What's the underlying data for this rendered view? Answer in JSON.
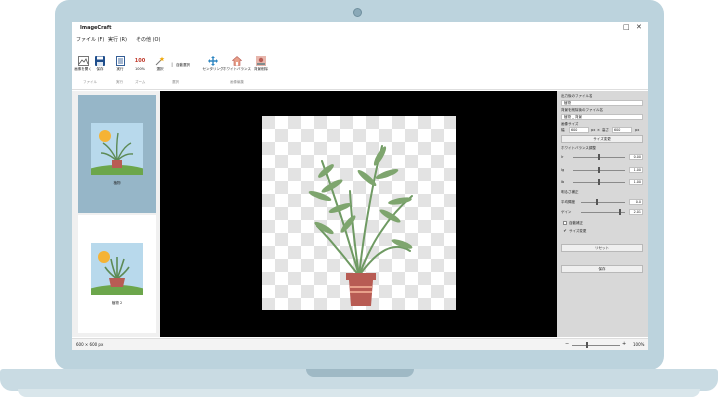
{
  "app": {
    "title": "ImageCraft"
  },
  "window": {
    "maximize": "□",
    "close": "✕"
  },
  "menu": {
    "file": "ファイル (F)",
    "run": "実行 (R)",
    "other": "その他 (O)"
  },
  "toolbar": {
    "open": "画像を開く",
    "save": "保存",
    "run": "実行",
    "zoom100_icon_text": "100",
    "zoom100": "100%",
    "select": "選択",
    "auto_select": "自動選択",
    "centering": "センタリング",
    "white_balance": "ホワイトバランス",
    "bg_remove": "背景削除"
  },
  "groups": {
    "file": "ファイル",
    "run": "実行",
    "zoom": "ズーム",
    "select": "選択",
    "edit": "画像編集"
  },
  "thumbnails": [
    {
      "name": "植物"
    },
    {
      "name": "植物 2"
    }
  ],
  "panel": {
    "output_file_label": "出力後のファイル名",
    "output_file_value": "植物",
    "bg_file_label": "背景を削除後のファイル名",
    "bg_file_value": "植物 _ 背景",
    "image_size_label": "画像サイズ",
    "width_label": "幅",
    "width_value": "600",
    "height_label": "高さ",
    "height_value": "600",
    "unit": "px",
    "times": "×",
    "resize_button": "サイズ変更",
    "wb_label": "ホワイトバランス調整",
    "r_label": "Ir",
    "r_value": "0.00",
    "g_label": "Ig",
    "g_value": "1.00",
    "b_label": "Ib",
    "b_value": "1.00",
    "tone_label": "明るさ補正",
    "average_label": "平均輝度",
    "average_value": "0.0",
    "gain_label": "ゲイン",
    "gain_value": "2.01",
    "auto_adjust": "自動補正",
    "resize_check": "サイズ変更",
    "reset_button": "リセット",
    "save_button": "保存"
  },
  "status": {
    "size": "600 × 600 px",
    "zoom_minus": "−",
    "zoom_plus": "+",
    "zoom_value": "100%"
  },
  "colors": {
    "frame": "#bcd3dd",
    "selected_thumb": "#96b6c8",
    "pot": "#b85c54",
    "leaf": "#6f9a63"
  }
}
